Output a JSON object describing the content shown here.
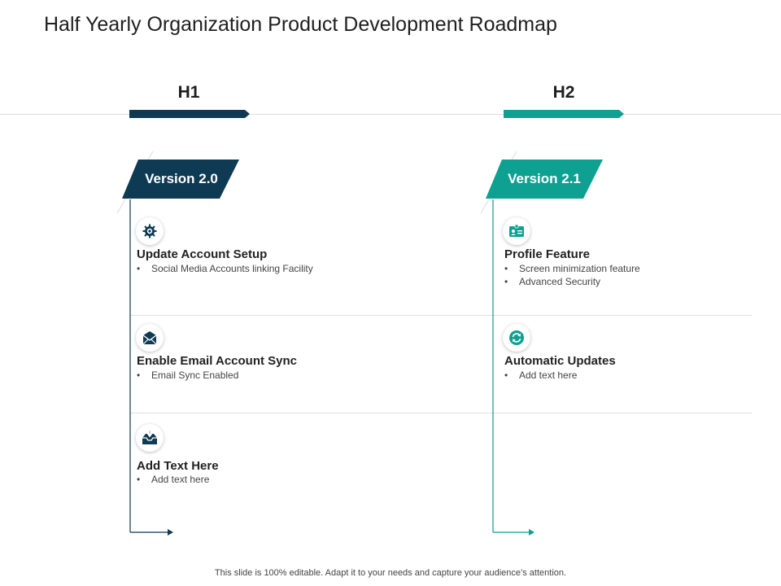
{
  "title": "Half Yearly Organization Product Development Roadmap",
  "colors": {
    "dark": "#0e3a53",
    "teal": "#0ea090"
  },
  "halves": [
    {
      "label": "H1",
      "version": "Version 2.0",
      "items": [
        {
          "icon": "gear-icon",
          "title": "Update Account Setup",
          "bullets": [
            "Social Media Accounts linking Facility"
          ]
        },
        {
          "icon": "envelope-icon",
          "title": "Enable Email Account Sync",
          "bullets": [
            "Email Sync Enabled"
          ]
        },
        {
          "icon": "inbox-download-icon",
          "title": "Add Text Here",
          "bullets": [
            "Add text here"
          ]
        }
      ]
    },
    {
      "label": "H2",
      "version": "Version 2.1",
      "items": [
        {
          "icon": "id-card-icon",
          "title": "Profile Feature",
          "bullets": [
            "Screen minimization feature",
            "Advanced Security"
          ]
        },
        {
          "icon": "refresh-icon",
          "title": "Automatic Updates",
          "bullets": [
            "Add text here"
          ]
        }
      ]
    }
  ],
  "footer": "This slide is 100% editable. Adapt it to your needs and capture your audience’s attention."
}
